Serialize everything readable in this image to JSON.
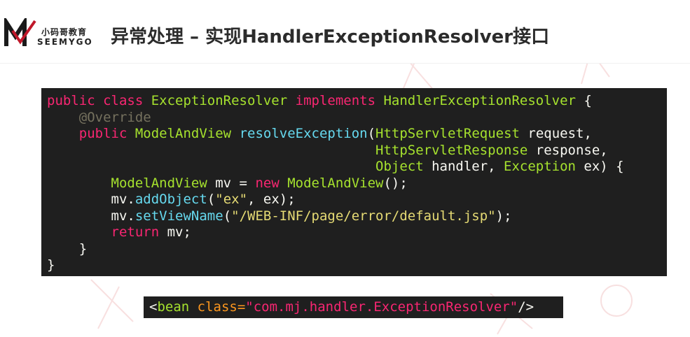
{
  "header": {
    "logo_cn": "小码哥教育",
    "logo_en": "SEEMYGO",
    "title": "异常处理 – 实现HandlerExceptionResolver接口"
  },
  "colors": {
    "keyword": "#f92672",
    "type": "#a6e22e",
    "method": "#66d9ef",
    "string": "#e6db74",
    "comment": "#75715e",
    "plain": "#f8f8f2",
    "xml_attr": "#fd971f",
    "xml_string": "#f92672",
    "brand": "#c0182a"
  },
  "code": {
    "lines": [
      [
        {
          "t": "public class ",
          "c": "keyword"
        },
        {
          "t": "ExceptionResolver ",
          "c": "type"
        },
        {
          "t": "implements ",
          "c": "keyword"
        },
        {
          "t": "HandlerExceptionResolver",
          "c": "type"
        },
        {
          "t": " {",
          "c": "plain"
        }
      ],
      [
        {
          "t": "    @Override",
          "c": "comment"
        }
      ],
      [
        {
          "t": "    public ",
          "c": "keyword"
        },
        {
          "t": "ModelAndView ",
          "c": "type"
        },
        {
          "t": "resolveException",
          "c": "method"
        },
        {
          "t": "(",
          "c": "plain"
        },
        {
          "t": "HttpServletRequest",
          "c": "type"
        },
        {
          "t": " request,",
          "c": "plain"
        }
      ],
      [
        {
          "t": "                                         ",
          "c": "plain"
        },
        {
          "t": "HttpServletResponse",
          "c": "type"
        },
        {
          "t": " response,",
          "c": "plain"
        }
      ],
      [
        {
          "t": "                                         ",
          "c": "plain"
        },
        {
          "t": "Object",
          "c": "type"
        },
        {
          "t": " handler, ",
          "c": "plain"
        },
        {
          "t": "Exception",
          "c": "type"
        },
        {
          "t": " ex) {",
          "c": "plain"
        }
      ],
      [
        {
          "t": "        ",
          "c": "plain"
        },
        {
          "t": "ModelAndView",
          "c": "type"
        },
        {
          "t": " mv = ",
          "c": "plain"
        },
        {
          "t": "new ",
          "c": "keyword"
        },
        {
          "t": "ModelAndView",
          "c": "type"
        },
        {
          "t": "();",
          "c": "plain"
        }
      ],
      [
        {
          "t": "        mv.",
          "c": "plain"
        },
        {
          "t": "addObject",
          "c": "method"
        },
        {
          "t": "(",
          "c": "plain"
        },
        {
          "t": "\"ex\"",
          "c": "string"
        },
        {
          "t": ", ex);",
          "c": "plain"
        }
      ],
      [
        {
          "t": "        mv.",
          "c": "plain"
        },
        {
          "t": "setViewName",
          "c": "method"
        },
        {
          "t": "(",
          "c": "plain"
        },
        {
          "t": "\"/WEB-INF/page/error/default.jsp\"",
          "c": "string"
        },
        {
          "t": ");",
          "c": "plain"
        }
      ],
      [
        {
          "t": "        ",
          "c": "plain"
        },
        {
          "t": "return ",
          "c": "keyword"
        },
        {
          "t": "mv;",
          "c": "plain"
        }
      ],
      [
        {
          "t": "    }",
          "c": "plain"
        }
      ],
      [
        {
          "t": "}",
          "c": "plain"
        }
      ]
    ]
  },
  "bean": {
    "lines": [
      [
        {
          "t": "<",
          "c": "plain"
        },
        {
          "t": "bean ",
          "c": "type"
        },
        {
          "t": "class=",
          "c": "xml_attr"
        },
        {
          "t": "\"com.mj.handler.ExceptionResolver\"",
          "c": "xml_string"
        },
        {
          "t": "/>",
          "c": "plain"
        }
      ]
    ]
  }
}
